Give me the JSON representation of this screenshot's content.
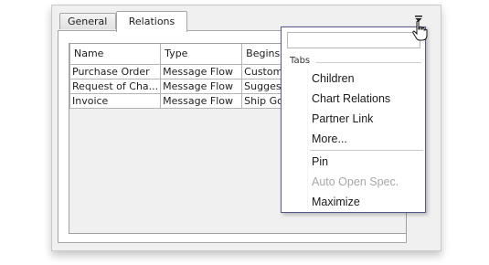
{
  "tabs": [
    {
      "label": "General"
    },
    {
      "label": "Relations"
    }
  ],
  "relations_table": {
    "columns": [
      "Name",
      "Type",
      "Begins"
    ],
    "rows": [
      [
        "Purchase Order",
        "Message Flow",
        "Customer"
      ],
      [
        "Request of Cha...",
        "Message Flow",
        "Suggest Ch"
      ],
      [
        "Invoice",
        "Message Flow",
        "Ship Goods"
      ]
    ]
  },
  "dropdown_menu": {
    "search_value": "",
    "group_label": "Tabs",
    "tab_items": [
      {
        "label": "Children",
        "enabled": true
      },
      {
        "label": "Chart Relations",
        "enabled": true
      },
      {
        "label": "Partner Link",
        "enabled": true
      },
      {
        "label": "More...",
        "enabled": true
      }
    ],
    "action_items": [
      {
        "label": "Pin",
        "enabled": true
      },
      {
        "label": "Auto Open Spec.",
        "enabled": false
      },
      {
        "label": "Maximize",
        "enabled": true
      }
    ]
  },
  "colors": {
    "menu_border": "#56588c",
    "disabled_text": "#a8a8a8"
  }
}
